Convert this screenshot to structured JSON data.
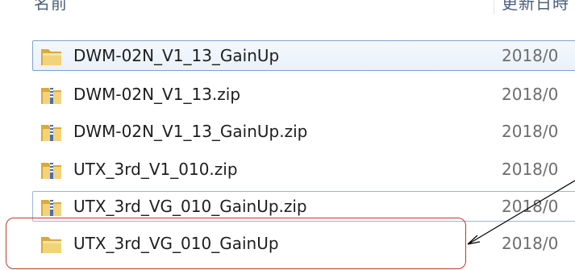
{
  "header": {
    "name_label": "名前",
    "date_label": "更新日時"
  },
  "files": [
    {
      "name": "DWM-02N_V1_13_GainUp",
      "date": "2018/0",
      "type": "folder",
      "state": "selected"
    },
    {
      "name": "DWM-02N_V1_13.zip",
      "date": "2018/0",
      "type": "zip",
      "state": "normal"
    },
    {
      "name": "DWM-02N_V1_13_GainUp.zip",
      "date": "2018/0",
      "type": "zip",
      "state": "normal"
    },
    {
      "name": "UTX_3rd_V1_010.zip",
      "date": "2018/0",
      "type": "zip",
      "state": "normal"
    },
    {
      "name": "UTX_3rd_VG_010_GainUp.zip",
      "date": "2018/0",
      "type": "zip",
      "state": "focused"
    },
    {
      "name": "UTX_3rd_VG_010_GainUp",
      "date": "2018/0",
      "type": "folder",
      "state": "normal"
    }
  ],
  "annotation": {
    "box_color": "#c0392b",
    "arrow_color": "#000000"
  },
  "colors": {
    "folder": "#e8c463",
    "zip_stripe": "#4a6fb0",
    "selection_border": "#7da2ce"
  }
}
